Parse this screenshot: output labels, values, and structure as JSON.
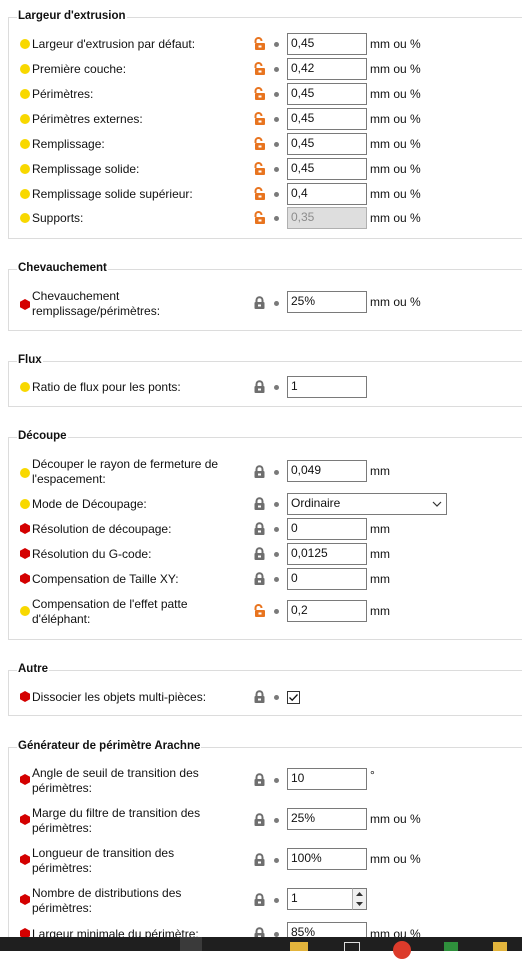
{
  "colors": {
    "simple_dot": "#f8d800",
    "expert_hex": "#d40000",
    "unlocked": "#e8741f",
    "locked": "#6e6e6e"
  },
  "groups": [
    {
      "title": "Largeur d'extrusion",
      "rows": [
        {
          "label": "Largeur d'extrusion par défaut:",
          "value": "0,45",
          "unit": "mm ou %"
        },
        {
          "label": "Première couche:",
          "value": "0,42",
          "unit": "mm ou %"
        },
        {
          "label": "Périmètres:",
          "value": "0,45",
          "unit": "mm ou %"
        },
        {
          "label": "Périmètres externes:",
          "value": "0,45",
          "unit": "mm ou %"
        },
        {
          "label": "Remplissage:",
          "value": "0,45",
          "unit": "mm ou %"
        },
        {
          "label": "Remplissage solide:",
          "value": "0,45",
          "unit": "mm ou %"
        },
        {
          "label": "Remplissage solide supérieur:",
          "value": "0,4",
          "unit": "mm ou %"
        },
        {
          "label": "Supports:",
          "value": "0,35",
          "unit": "mm ou %"
        }
      ]
    },
    {
      "title": "Chevauchement",
      "rows": [
        {
          "label_line1": "Chevauchement",
          "label_line2": "remplissage/périmètres:",
          "value": "25%",
          "unit": "mm ou %"
        }
      ]
    },
    {
      "title": "Flux",
      "rows": [
        {
          "label": "Ratio de flux pour les ponts:",
          "value": "1"
        }
      ]
    },
    {
      "title": "Découpe",
      "rows": [
        {
          "label_line1": "Découper le rayon de fermeture de",
          "label_line2": "l'espacement:",
          "value": "0,049",
          "unit": "mm"
        },
        {
          "label": "Mode de Découpage:",
          "value": "Ordinaire"
        },
        {
          "label": "Résolution de découpage:",
          "value": "0",
          "unit": "mm"
        },
        {
          "label": "Résolution du G-code:",
          "value": "0,0125",
          "unit": "mm"
        },
        {
          "label": "Compensation de Taille XY:",
          "value": "0",
          "unit": "mm"
        },
        {
          "label_line1": "Compensation de l'effet patte",
          "label_line2": "d'éléphant:",
          "value": "0,2",
          "unit": "mm"
        }
      ]
    },
    {
      "title": "Autre",
      "rows": [
        {
          "label": "Dissocier les objets multi-pièces:",
          "checked": true
        }
      ]
    },
    {
      "title": "Générateur de périmètre Arachne",
      "rows": [
        {
          "label_line1": "Angle de seuil de transition des",
          "label_line2": "périmètres:",
          "value": "10",
          "unit": "°"
        },
        {
          "label_line1": "Marge du filtre de transition des",
          "label_line2": "périmètres:",
          "value": "25%",
          "unit": "mm ou %"
        },
        {
          "label_line1": "Longueur de transition des",
          "label_line2": "périmètres:",
          "value": "100%",
          "unit": "mm ou %"
        },
        {
          "label_line1": "Nombre de distributions des",
          "label_line2": "périmètres:",
          "value": "1"
        },
        {
          "label": "Largeur minimale du périmètre:",
          "value": "85%",
          "unit": "mm ou %"
        }
      ]
    }
  ]
}
